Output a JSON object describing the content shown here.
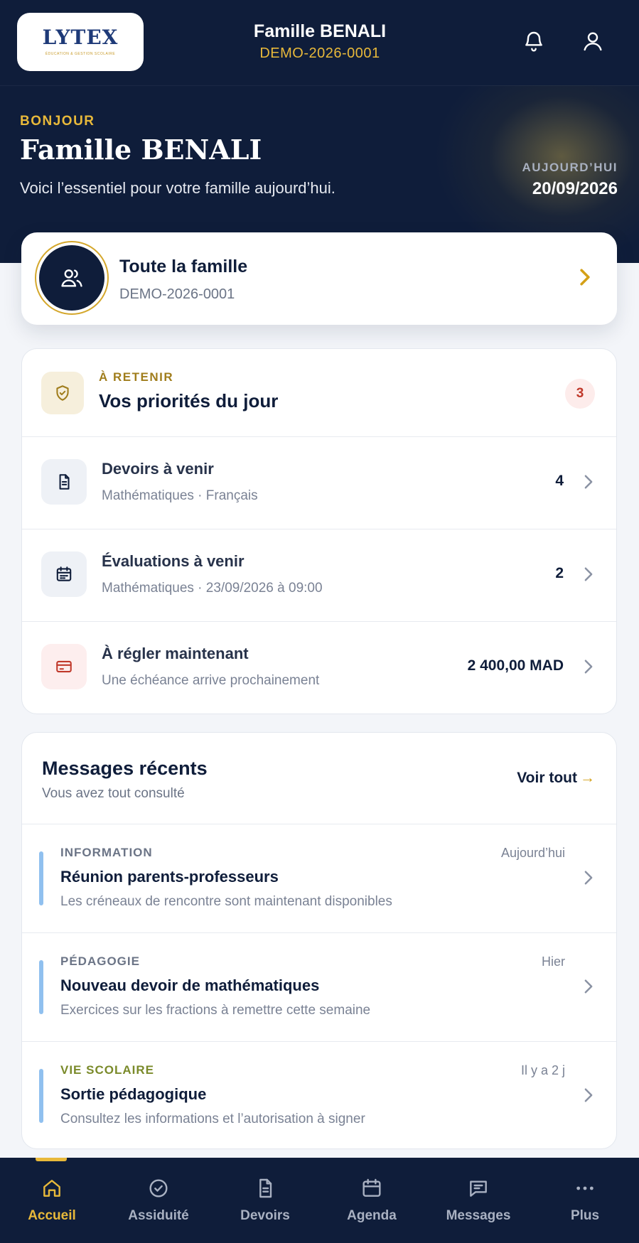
{
  "header": {
    "logo_text": "LYTEX",
    "logo_sub": "ÉDUCATION & GESTION SCOLAIRE",
    "family_name": "Famille BENALI",
    "family_code": "DEMO-2026-0001"
  },
  "hero": {
    "greeting": "BONJOUR",
    "name": "Famille BENALI",
    "subtitle": "Voici l’essentiel pour votre famille aujourd’hui.",
    "today_label": "AUJOURD’HUI",
    "today_date": "20/09/2026"
  },
  "family_card": {
    "title": "Toute la famille",
    "code": "DEMO-2026-0001"
  },
  "priorities": {
    "eyebrow": "À RETENIR",
    "title": "Vos priorités du jour",
    "count": "3",
    "items": [
      {
        "title": "Devoirs à venir",
        "subtitle": "Mathématiques · Français",
        "value": "4",
        "icon": "document-icon"
      },
      {
        "title": "Évaluations à venir",
        "subtitle": "Mathématiques · 23/09/2026 à 09:00",
        "value": "2",
        "icon": "calendar-icon"
      },
      {
        "title": "À régler maintenant",
        "subtitle": "Une échéance arrive prochainement",
        "value": "2 400,00 MAD",
        "icon": "credit-card-icon"
      }
    ]
  },
  "messages": {
    "title": "Messages récents",
    "subtitle": "Vous avez tout consulté",
    "see_all": "Voir tout",
    "see_all_arrow": "→",
    "items": [
      {
        "category": "INFORMATION",
        "time": "Aujourd’hui",
        "title": "Réunion parents-professeurs",
        "desc": "Les créneaux de rencontre sont maintenant disponibles"
      },
      {
        "category": "PÉDAGOGIE",
        "time": "Hier",
        "title": "Nouveau devoir de mathématiques",
        "desc": "Exercices sur les fractions à remettre cette semaine"
      },
      {
        "category": "VIE SCOLAIRE",
        "time": "Il y a 2 j",
        "title": "Sortie pédagogique",
        "desc": "Consultez les informations et l’autorisation à signer"
      }
    ]
  },
  "tabs": [
    {
      "label": "Accueil",
      "icon": "home-icon",
      "active": true
    },
    {
      "label": "Assiduité",
      "icon": "check-circle-icon"
    },
    {
      "label": "Devoirs",
      "icon": "document-icon"
    },
    {
      "label": "Agenda",
      "icon": "calendar-icon"
    },
    {
      "label": "Messages",
      "icon": "chat-icon"
    },
    {
      "label": "Plus",
      "icon": "more-icon"
    }
  ],
  "colors": {
    "navy": "#0f1d3a",
    "gold": "#e8b93a",
    "badge_red": "#c0392b",
    "message_bar": "#90c0ef"
  }
}
